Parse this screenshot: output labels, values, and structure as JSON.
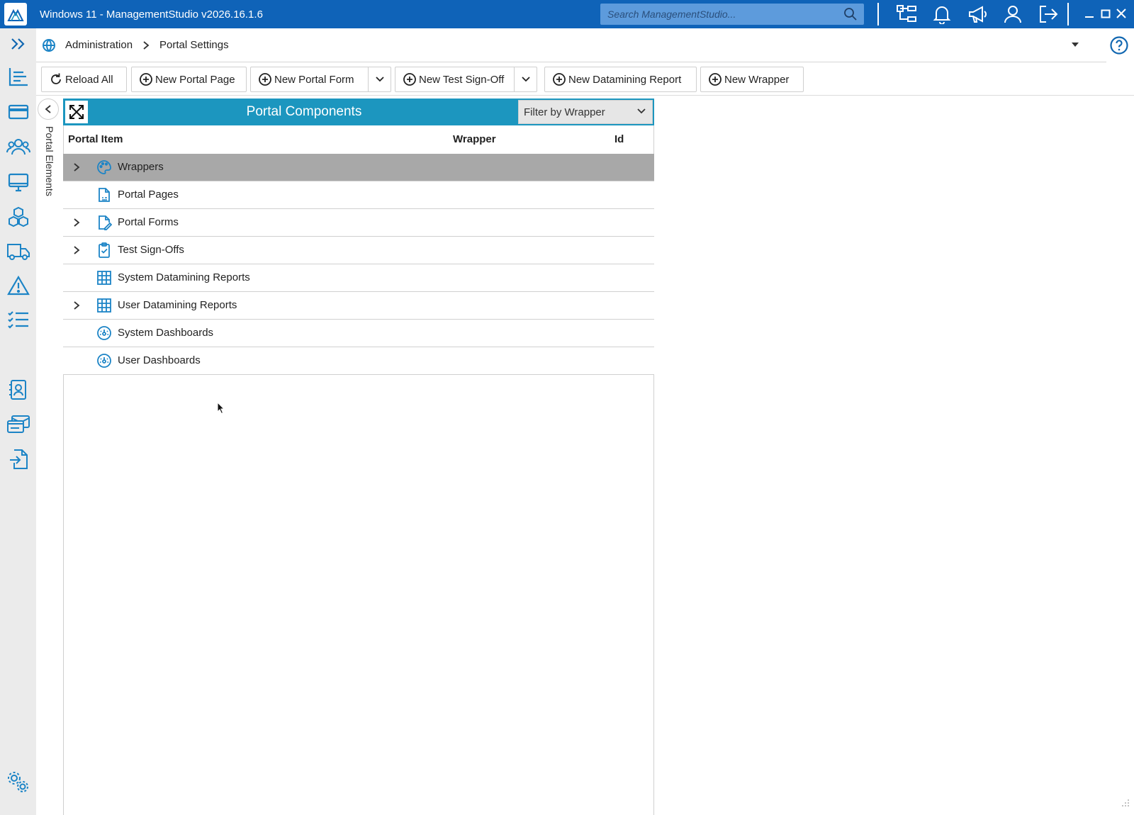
{
  "window": {
    "title": "Windows 11 - ManagementStudio v2026.16.1.6",
    "search_placeholder": "Search ManagementStudio...",
    "brand_color": "#0f63b8"
  },
  "breadcrumb": {
    "items": [
      "Administration",
      "Portal Settings"
    ]
  },
  "toolbar": {
    "reload_all": "Reload All",
    "new_portal_page": "New Portal Page",
    "new_portal_form": "New Portal Form",
    "new_test_signoff": "New Test Sign-Off",
    "new_datamining_report": "New Datamining Report",
    "new_wrapper": "New Wrapper"
  },
  "side_panel": {
    "label": "Portal Elements"
  },
  "panel": {
    "title": "Portal Components",
    "header_color": "#1c96bf",
    "filter_value": "Filter by Wrapper",
    "columns": [
      "Portal Item",
      "Wrapper",
      "Id"
    ],
    "rows": [
      {
        "label": "Wrappers",
        "expandable": true,
        "selected": true,
        "icon": "palette-icon"
      },
      {
        "label": "Portal Pages",
        "expandable": false,
        "selected": false,
        "icon": "doc-page-icon"
      },
      {
        "label": "Portal Forms",
        "expandable": true,
        "selected": false,
        "icon": "form-edit-icon"
      },
      {
        "label": "Test Sign-Offs",
        "expandable": true,
        "selected": false,
        "icon": "clipboard-check-icon"
      },
      {
        "label": "System Datamining Reports",
        "expandable": false,
        "selected": false,
        "icon": "grid-icon"
      },
      {
        "label": "User Datamining Reports",
        "expandable": true,
        "selected": false,
        "icon": "grid-icon"
      },
      {
        "label": "System Dashboards",
        "expandable": false,
        "selected": false,
        "icon": "gauge-icon"
      },
      {
        "label": "User Dashboards",
        "expandable": false,
        "selected": false,
        "icon": "gauge-icon"
      }
    ]
  }
}
